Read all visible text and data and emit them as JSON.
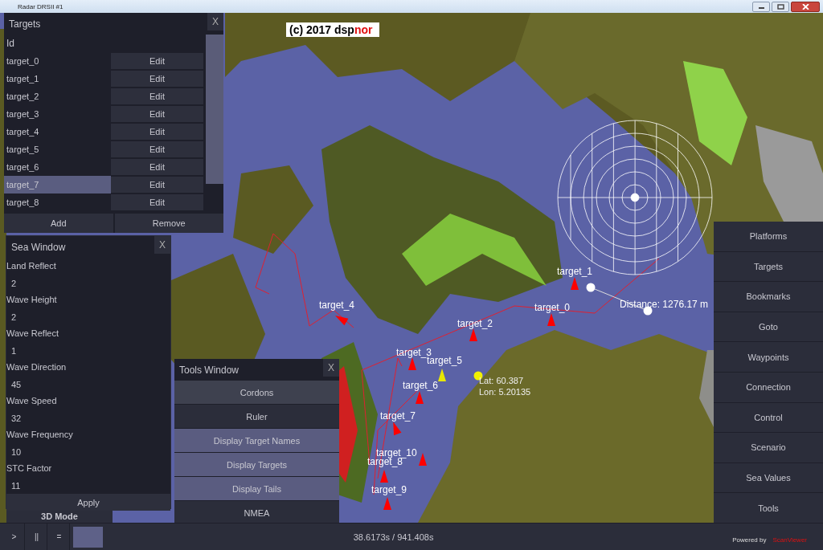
{
  "window": {
    "title": "Radar DRSII #1"
  },
  "map": {
    "copyright": {
      "text": "(c) 2017 dsp",
      "accent": "nor"
    },
    "targets": [
      {
        "label": "target_1",
        "color": "#ff0000"
      },
      {
        "label": "target_4",
        "color": "#ff0000"
      },
      {
        "label": "target_0",
        "color": "#ff0000"
      },
      {
        "label": "target_2",
        "color": "#ff0000"
      },
      {
        "label": "target_3",
        "color": "#ff0000"
      },
      {
        "label": "target_5",
        "color": "#e8e800"
      },
      {
        "label": "target_6",
        "color": "#ff0000"
      },
      {
        "label": "target_7",
        "color": "#ff0000"
      },
      {
        "label": "target_10",
        "color": "#ff0000"
      },
      {
        "label": "target_8",
        "color": "#ff0000"
      },
      {
        "label": "target_9",
        "color": "#ff0000"
      }
    ],
    "position": {
      "lat": "Lat: 60.387",
      "lon": "Lon: 5.20135"
    },
    "ruler": {
      "distance": "Distance: 1276.17 m"
    }
  },
  "targets_window": {
    "title": "Targets",
    "close": "X",
    "column": "Id",
    "rows": [
      {
        "id": "target_0",
        "action": "Edit",
        "selected": false
      },
      {
        "id": "target_1",
        "action": "Edit",
        "selected": false
      },
      {
        "id": "target_2",
        "action": "Edit",
        "selected": false
      },
      {
        "id": "target_3",
        "action": "Edit",
        "selected": false
      },
      {
        "id": "target_4",
        "action": "Edit",
        "selected": false
      },
      {
        "id": "target_5",
        "action": "Edit",
        "selected": false
      },
      {
        "id": "target_6",
        "action": "Edit",
        "selected": false
      },
      {
        "id": "target_7",
        "action": "Edit",
        "selected": true
      },
      {
        "id": "target_8",
        "action": "Edit",
        "selected": false
      }
    ],
    "buttons": [
      "Add",
      "Remove"
    ]
  },
  "sea_window": {
    "title": "Sea Window",
    "close": "X",
    "fields": [
      {
        "label": "Land Reflect",
        "value": "2"
      },
      {
        "label": "Wave Height",
        "value": "2"
      },
      {
        "label": "Wave Reflect",
        "value": "1"
      },
      {
        "label": "Wave Direction",
        "value": "45"
      },
      {
        "label": "Wave Speed",
        "value": "32"
      },
      {
        "label": "Wave Frequency",
        "value": "10"
      },
      {
        "label": "STC Factor",
        "value": "11"
      }
    ],
    "apply": "Apply"
  },
  "mode_button": "3D Mode",
  "tools_window": {
    "title": "Tools Window",
    "close": "X",
    "buttons": [
      {
        "label": "Cordons",
        "on": false,
        "hovered": true
      },
      {
        "label": "Ruler",
        "on": false,
        "hovered": false
      },
      {
        "label": "Display Target Names",
        "on": true,
        "hovered": false
      },
      {
        "label": "Display Targets",
        "on": true,
        "hovered": false
      },
      {
        "label": "Display Tails",
        "on": true,
        "hovered": false
      },
      {
        "label": "NMEA",
        "on": false,
        "hovered": false
      }
    ]
  },
  "side_menu": [
    "Platforms",
    "Targets",
    "Bookmarks",
    "Goto",
    "Waypoints",
    "Connection",
    "Control",
    "Scenario",
    "Sea Values",
    "Tools"
  ],
  "playback": {
    "controls": [
      ">",
      "||",
      "="
    ],
    "time": "38.6173s / 941.408s",
    "credit": {
      "text": "Powered by",
      "brand": "ScanViewer"
    }
  }
}
